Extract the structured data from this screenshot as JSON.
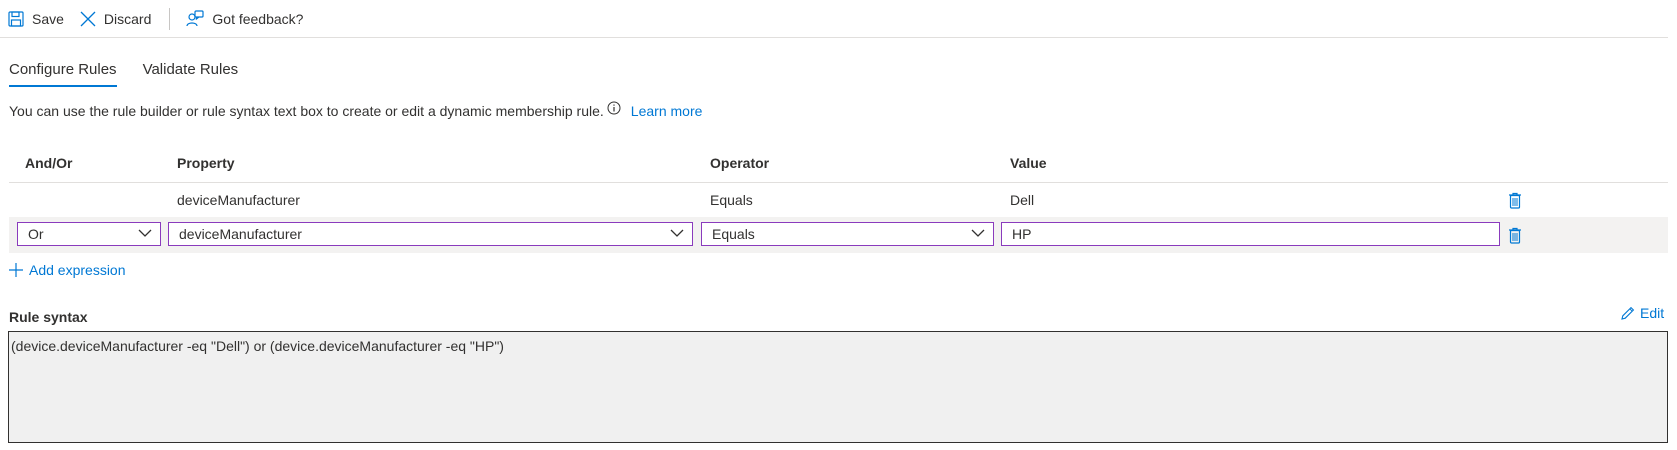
{
  "toolbar": {
    "save_label": "Save",
    "discard_label": "Discard",
    "feedback_label": "Got feedback?"
  },
  "tabs": [
    {
      "label": "Configure Rules",
      "active": true
    },
    {
      "label": "Validate Rules",
      "active": false
    }
  ],
  "description": {
    "text": "You can use the rule builder or rule syntax text box to create or edit a dynamic membership rule.",
    "learn_more": "Learn more"
  },
  "grid": {
    "columns": [
      "And/Or",
      "Property",
      "Operator",
      "Value"
    ],
    "rows": [
      {
        "andor": "",
        "property": "deviceManufacturer",
        "operator": "Equals",
        "value": "Dell"
      },
      {
        "andor": "Or",
        "property": "deviceManufacturer",
        "operator": "Equals",
        "value": "HP"
      }
    ]
  },
  "add_expression_label": "Add expression",
  "rule_syntax": {
    "label": "Rule syntax",
    "edit_label": "Edit",
    "text": "(device.deviceManufacturer -eq \"Dell\") or (device.deviceManufacturer -eq \"HP\")"
  },
  "colors": {
    "accent": "#0078d4",
    "field_border": "#8a3bbd",
    "row_highlight": "#f3f2f1"
  }
}
